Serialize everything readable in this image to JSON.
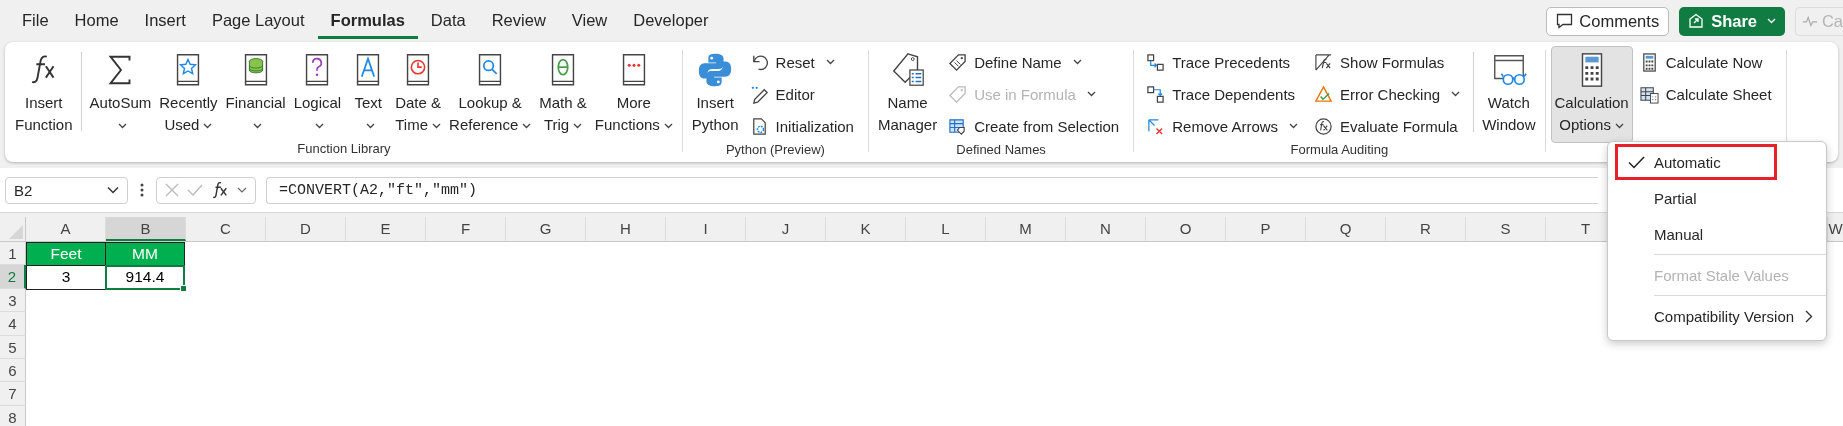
{
  "menu_tabs": [
    {
      "label": "File",
      "selected": false
    },
    {
      "label": "Home",
      "selected": false
    },
    {
      "label": "Insert",
      "selected": false
    },
    {
      "label": "Page Layout",
      "selected": false
    },
    {
      "label": "Formulas",
      "selected": true
    },
    {
      "label": "Data",
      "selected": false
    },
    {
      "label": "Review",
      "selected": false
    },
    {
      "label": "View",
      "selected": false
    },
    {
      "label": "Developer",
      "selected": false
    }
  ],
  "top_buttons": [
    {
      "label": "Comments",
      "kind": "outline"
    },
    {
      "label": "Share",
      "kind": "primary"
    },
    {
      "label": "Ca",
      "kind": "disabled"
    }
  ],
  "ribbon": {
    "groups": [
      {
        "label": "Function Library",
        "items": [
          {
            "kind": "large",
            "label": "Insert\nFunction",
            "dropdown": false,
            "pressed": false
          },
          {
            "kind": "separator"
          },
          {
            "kind": "large",
            "label": "AutoSum\n",
            "dropdown": true,
            "pressed": false
          },
          {
            "kind": "large",
            "label": "Recently\nUsed",
            "dropdown": true,
            "pressed": false
          },
          {
            "kind": "large",
            "label": "Financial\n",
            "dropdown": true,
            "pressed": false
          },
          {
            "kind": "large",
            "label": "Logical\n",
            "dropdown": true,
            "pressed": false
          },
          {
            "kind": "large",
            "label": "Text\n",
            "dropdown": true,
            "pressed": false
          },
          {
            "kind": "large",
            "label": "Date &\nTime",
            "dropdown": true,
            "pressed": false
          },
          {
            "kind": "large",
            "label": "Lookup &\nReference",
            "dropdown": true,
            "pressed": false
          },
          {
            "kind": "large",
            "label": "Math &\nTrig",
            "dropdown": true,
            "pressed": false
          },
          {
            "kind": "large",
            "label": "More\nFunctions",
            "dropdown": true,
            "pressed": false
          }
        ]
      },
      {
        "label": "Python (Preview)",
        "items": [
          {
            "kind": "large",
            "label": "Insert\nPython",
            "dropdown": false,
            "pressed": false
          },
          {
            "kind": "stack",
            "items": [
              {
                "label": "Reset",
                "dropdown": true,
                "disabled": false
              },
              {
                "label": "Editor",
                "dropdown": false,
                "disabled": false
              },
              {
                "label": "Initialization",
                "dropdown": false,
                "disabled": false
              }
            ]
          }
        ]
      },
      {
        "label": "Defined Names",
        "items": [
          {
            "kind": "large",
            "label": "Name\nManager",
            "dropdown": false,
            "pressed": false
          },
          {
            "kind": "stack",
            "items": [
              {
                "label": "Define Name",
                "dropdown": true,
                "disabled": false
              },
              {
                "label": "Use in Formula",
                "dropdown": true,
                "disabled": true
              },
              {
                "label": "Create from Selection",
                "dropdown": false,
                "disabled": false
              }
            ]
          }
        ]
      },
      {
        "label": "Formula Auditing",
        "items": [
          {
            "kind": "stack",
            "items": [
              {
                "label": "Trace Precedents",
                "dropdown": false,
                "disabled": false
              },
              {
                "label": "Trace Dependents",
                "dropdown": false,
                "disabled": false
              },
              {
                "label": "Remove Arrows",
                "dropdown": true,
                "disabled": false
              }
            ]
          },
          {
            "kind": "stack",
            "items": [
              {
                "label": "Show Formulas",
                "dropdown": false,
                "disabled": false
              },
              {
                "label": "Error Checking",
                "dropdown": true,
                "disabled": false
              },
              {
                "label": "Evaluate Formula",
                "dropdown": false,
                "disabled": false
              }
            ]
          },
          {
            "kind": "separator"
          },
          {
            "kind": "large",
            "label": "Watch\nWindow",
            "dropdown": false,
            "pressed": false
          }
        ]
      },
      {
        "items": [
          {
            "kind": "large",
            "label": "Calculation\nOptions",
            "dropdown": true,
            "pressed": true
          },
          {
            "kind": "stack",
            "items": [
              {
                "label": "Calculate Now",
                "dropdown": false,
                "disabled": false
              },
              {
                "label": "Calculate Sheet",
                "dropdown": false,
                "disabled": false
              }
            ]
          }
        ]
      }
    ]
  },
  "formula_bar": {
    "name_box": "B2",
    "formula": "=CONVERT(A2,\"ft\",\"mm\")"
  },
  "sheet": {
    "columns": [
      {
        "label": "A",
        "selected": false
      },
      {
        "label": "B",
        "selected": true
      },
      {
        "label": "C",
        "selected": false
      },
      {
        "label": "D",
        "selected": false
      },
      {
        "label": "E",
        "selected": false
      },
      {
        "label": "F",
        "selected": false
      },
      {
        "label": "G",
        "selected": false
      },
      {
        "label": "H",
        "selected": false
      },
      {
        "label": "I",
        "selected": false
      },
      {
        "label": "J",
        "selected": false
      },
      {
        "label": "K",
        "selected": false
      },
      {
        "label": "L",
        "selected": false
      },
      {
        "label": "M",
        "selected": false
      },
      {
        "label": "N",
        "selected": false
      },
      {
        "label": "O",
        "selected": false
      },
      {
        "label": "P",
        "selected": false
      },
      {
        "label": "Q",
        "selected": false
      },
      {
        "label": "R",
        "selected": false
      },
      {
        "label": "S",
        "selected": false
      },
      {
        "label": "T",
        "selected": false
      }
    ],
    "last_column": {
      "label": "W",
      "selected": false
    },
    "rows": [
      {
        "label": "1",
        "selected": false,
        "cells": [
          {
            "value": "Feet",
            "kind": "heading",
            "selected": false
          },
          {
            "value": "MM",
            "kind": "heading",
            "selected": false
          }
        ]
      },
      {
        "label": "2",
        "selected": true,
        "cells": [
          {
            "value": "3",
            "kind": "value",
            "selected": false
          },
          {
            "value": "914.4",
            "kind": "value",
            "selected": true
          }
        ]
      },
      {
        "label": "3",
        "selected": false
      },
      {
        "label": "4",
        "selected": false
      },
      {
        "label": "5",
        "selected": false
      },
      {
        "label": "6",
        "selected": false
      },
      {
        "label": "7",
        "selected": false
      },
      {
        "label": "8",
        "selected": false
      }
    ]
  },
  "calc_menu": {
    "items": [
      {
        "kind": "option",
        "label": "Automatic",
        "selected": true,
        "highlighted": true,
        "disabled": false
      },
      {
        "kind": "option",
        "label": "Partial",
        "selected": false,
        "highlighted": false,
        "disabled": false
      },
      {
        "kind": "option",
        "label": "Manual",
        "selected": false,
        "highlighted": false,
        "disabled": false
      },
      {
        "kind": "command",
        "label": "Format Stale Values",
        "selected": false,
        "highlighted": false,
        "disabled": true
      },
      {
        "kind": "submenu",
        "label": "Compatibility Version",
        "selected": false,
        "highlighted": false,
        "disabled": false
      }
    ]
  }
}
